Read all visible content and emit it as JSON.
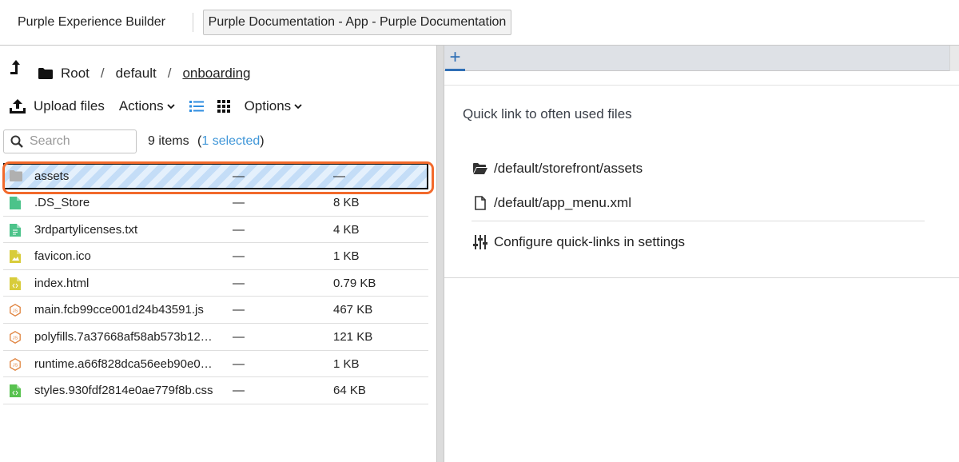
{
  "header": {
    "app_title": "Purple Experience Builder",
    "doc_tab": "Purple Documentation - App - Purple Documentation"
  },
  "breadcrumb": {
    "items": [
      "Root",
      "default",
      "onboarding"
    ]
  },
  "toolbar": {
    "upload_label": "Upload files",
    "actions_label": "Actions",
    "options_label": "Options"
  },
  "search": {
    "placeholder": "Search",
    "value": ""
  },
  "summary": {
    "count": "9 items",
    "selected_prefix": "(",
    "selected": "1 selected",
    "selected_suffix": ")"
  },
  "files": [
    {
      "name": "assets",
      "date": "—",
      "size": "—",
      "icon": "folder-icon",
      "color": "#b0b0b0",
      "selected": true
    },
    {
      "name": ".DS_Store",
      "date": "—",
      "size": "8 KB",
      "icon": "file-icon",
      "color": "#4cc38a"
    },
    {
      "name": "3rdpartylicenses.txt",
      "date": "—",
      "size": "4 KB",
      "icon": "text-file-icon",
      "color": "#4cc38a"
    },
    {
      "name": "favicon.ico",
      "date": "—",
      "size": "1 KB",
      "icon": "image-file-icon",
      "color": "#d8cc3a"
    },
    {
      "name": "index.html",
      "date": "—",
      "size": "0.79 KB",
      "icon": "code-file-icon",
      "color": "#d8cc3a"
    },
    {
      "name": "main.fcb99cce001d24b43591.js",
      "date": "—",
      "size": "467 KB",
      "icon": "js-file-icon",
      "color": "#e0833e"
    },
    {
      "name": "polyfills.7a37668af58ab573b12…",
      "date": "—",
      "size": "121 KB",
      "icon": "js-file-icon",
      "color": "#e0833e"
    },
    {
      "name": "runtime.a66f828dca56eeb90e0…",
      "date": "—",
      "size": "1 KB",
      "icon": "js-file-icon",
      "color": "#e0833e"
    },
    {
      "name": "styles.930fdf2814e0ae779f8b.css",
      "date": "—",
      "size": "64 KB",
      "icon": "css-file-icon",
      "color": "#58c24f"
    }
  ],
  "quick_links": {
    "title": "Quick link to often used files",
    "items": [
      {
        "label": "/default/storefront/assets",
        "icon": "folder-open-icon"
      },
      {
        "label": "/default/app_menu.xml",
        "icon": "file-icon"
      }
    ],
    "configure_label": "Configure quick-links in settings"
  },
  "colors": {
    "accent": "#3f96d8",
    "tab_accent": "#2f6fb5",
    "highlight_ring": "#f26a2c"
  }
}
